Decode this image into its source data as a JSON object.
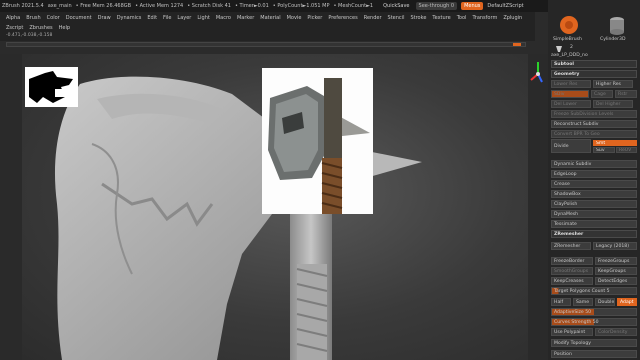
{
  "titlebar": {
    "app": "ZBrush 2021.5.4",
    "doc": "axe_main",
    "free_mem": "• Free Mem 26.468GB",
    "active_mem": "• Active Mem 1274",
    "scratch": "• Scratch Disk 41",
    "timer": "• Timer►0.01",
    "polycount": "• PolyCount►1.051 MP",
    "meshcount": "• MeshCount►1",
    "quicksave": "QuickSave",
    "seethrough": "See-through  0",
    "menus": "Menus",
    "default_script": "DefaultZScript"
  },
  "menubar": [
    "Alpha",
    "Brush",
    "Color",
    "Document",
    "Draw",
    "Dynamics",
    "Edit",
    "File",
    "Layer",
    "Light",
    "Macro",
    "Marker",
    "Material",
    "Movie",
    "Picker",
    "Preferences",
    "Render",
    "Stencil",
    "Stroke",
    "Texture",
    "Tool",
    "Transform",
    "Zplugin"
  ],
  "menubar2": [
    "Zscript",
    "Zbrushes",
    "Help"
  ],
  "coords": "-0.471,-0.038,-0.158",
  "brushes": {
    "simple": "SimpleBrush",
    "cylinder": "Cylinder3D",
    "current_tool": "axe_LP_DDD_no",
    "tool_count": "2"
  },
  "panel": {
    "subtool": "Subtool",
    "geometry": "Geometry",
    "lower_res": "Lower Res",
    "higher_res": "Higher Res",
    "sdiv": "SDiv",
    "cage": "Cage",
    "rstr": "Rstr",
    "del_lower": "Del Lower",
    "del_higher": "Del Higher",
    "freeze_sub": "Freeze SubDivision Levels",
    "reconstruct": "Reconstruct Subdiv",
    "convert_bpr": "Convert BPR To Geo",
    "divide": "Divide",
    "smt": "Smt",
    "suv": "Suv",
    "reuv": "ReUV",
    "dynamic_subdiv": "Dynamic Subdiv",
    "edgeloop": "EdgeLoop",
    "crease": "Crease",
    "shadowbox": "ShadowBox",
    "claypolish": "ClayPolish",
    "dynamesh": "DynaMesh",
    "tessimate": "Tessimate",
    "zremesher_sect": "ZRemesher",
    "zremesher_btn": "ZRemesher",
    "legacy": "Legacy (2018)",
    "freezeborder": "FreezeBorder",
    "freezegroups": "FreezeGroups",
    "smoothgroups": "SmoothGroups",
    "keepgroups": "KeepGroups",
    "keepcreases": "KeepCreases",
    "detectedges": "DetectEdges",
    "target_label": "Target Polygons Count 5",
    "half": "Half",
    "same": "Same",
    "double": "Double",
    "adapt": "Adapt",
    "adaptivesize": "AdaptiveSize 50",
    "curves_strength": "Curves Strength 50",
    "use_polypaint": "Use Polypaint",
    "colordensity": "ColorDensity",
    "modify_topology": "Modify Topology",
    "position": "Position"
  },
  "colors": {
    "accent": "#e0651f"
  }
}
